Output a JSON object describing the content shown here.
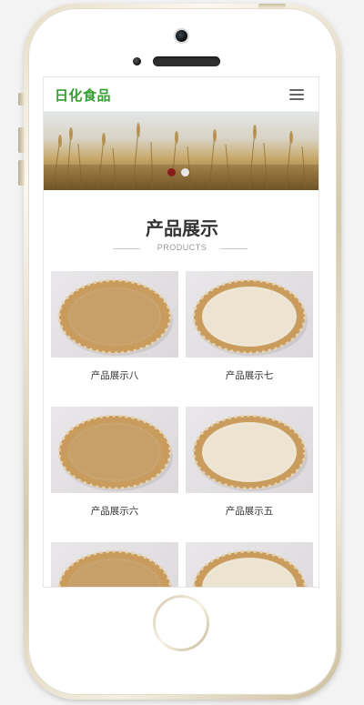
{
  "header": {
    "logo": "日化食品",
    "menu_icon": "hamburger-menu-icon"
  },
  "banner": {
    "image": "wheat-field",
    "slides": 2,
    "active_slide": 1,
    "colors": {
      "active_dot": "#8b1a1a",
      "inactive_dot": "#e7e7e7"
    }
  },
  "products_section": {
    "title": "产品展示",
    "subtitle": "PRODUCTS"
  },
  "products": [
    {
      "name": "产品展示八",
      "grain": "brown"
    },
    {
      "name": "产品展示七",
      "grain": "white"
    },
    {
      "name": "产品展示六",
      "grain": "brown"
    },
    {
      "name": "产品展示五",
      "grain": "white"
    },
    {
      "name": "",
      "grain": "brown"
    },
    {
      "name": "",
      "grain": "white"
    }
  ],
  "colors": {
    "brand_green": "#32a02e",
    "heading": "#333333",
    "muted": "#999999"
  }
}
